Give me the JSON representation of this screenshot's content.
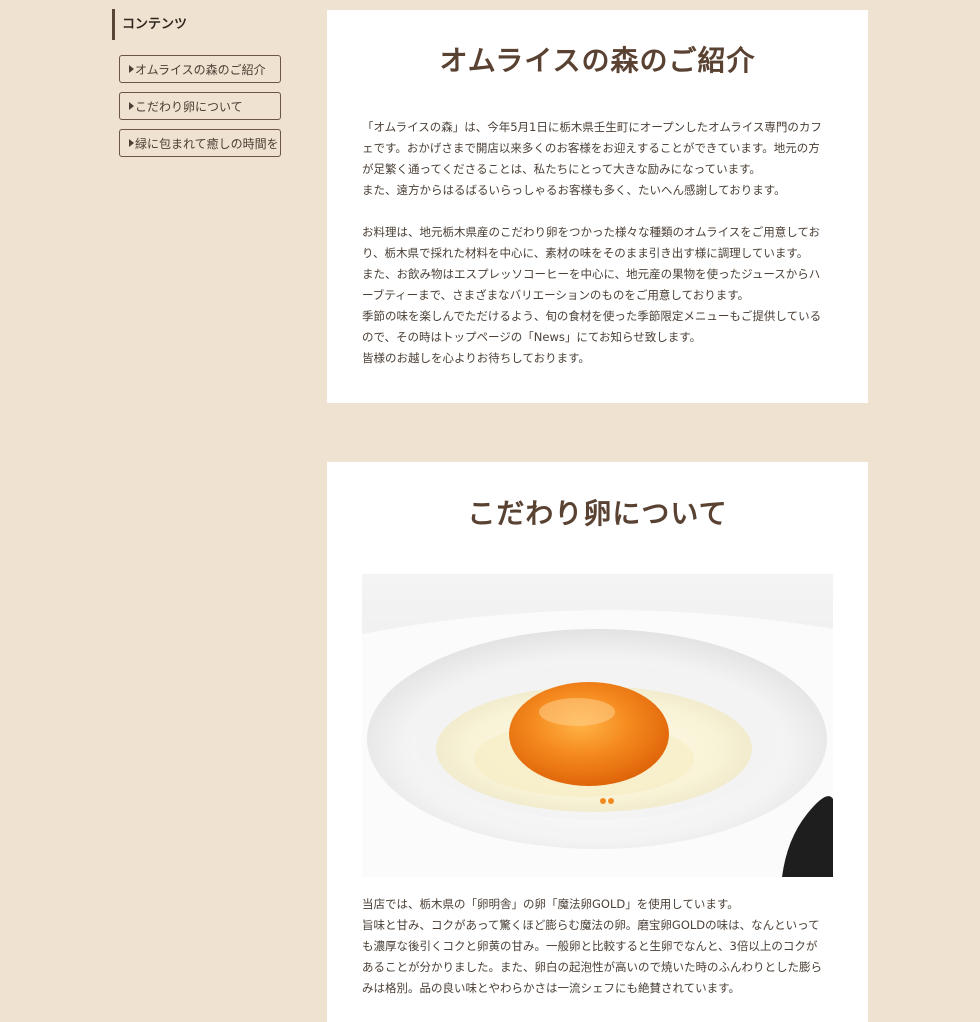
{
  "sidebar": {
    "heading": "コンテンツ",
    "items": [
      {
        "label": "オムライスの森のご紹介"
      },
      {
        "label": "こだわり卵について"
      },
      {
        "label": "緑に包まれて癒しの時間を"
      }
    ]
  },
  "intro": {
    "title": "オムライスの森のご紹介",
    "paragraph1": [
      "「オムライスの森」は、今年5月1日に栃木県壬生町にオープンしたオムライス専門のカフ",
      "ェです。おかげさまで開店以来多くのお客様をお迎えすることができています。地元の方",
      "が足繁く通ってくださることは、私たちにとって大きな励みになっています。",
      "また、遠方からはるばるいらっしゃるお客様も多く、たいへん感謝しております。"
    ],
    "paragraph2": [
      "お料理は、地元栃木県産のこだわり卵をつかった様々な種類のオムライスをご用意してお",
      "り、栃木県で採れた材料を中心に、素材の味をそのまま引き出す様に調理しています。",
      "また、お飲み物はエスプレッソコーヒーを中心に、地元産の果物を使ったジュースからハ",
      "ーブティーまで、さまざまなバリエーションのものをご用意しております。",
      "季節の味を楽しんでただけるよう、旬の食材を使った季節限定メニューもご提供している",
      "ので、その時はトップページの「News」にてお知らせ致します。",
      "皆様のお越しを心よりお待ちしております。"
    ]
  },
  "egg": {
    "title": "こだわり卵について",
    "paragraph": [
      "当店では、栃木県の「卵明舎」の卵「魔法卵GOLD」を使用しています。",
      "旨味と甘み、コクがあって驚くほど膨らむ魔法の卵。磨宝卵GOLDの味は、なんといって",
      "も濃厚な後引くコクと卵黄の甘み。一般卵と比較すると生卵でなんと、3倍以上のコクが",
      "あることが分かりました。また、卵白の起泡性が高いので焼いた時のふんわりとした膨ら",
      "みは格別。品の良い味とやわらかさは一流シェフにも絶賛されています。"
    ]
  },
  "colors": {
    "page_background": "#f0e2d0",
    "card_background": "#ffffff",
    "heading_brown": "#5a4232",
    "body_text": "#4a3f35",
    "yolk_orange": "#f07a10"
  },
  "icons": {
    "nav_marker": "triangle-right-icon"
  }
}
